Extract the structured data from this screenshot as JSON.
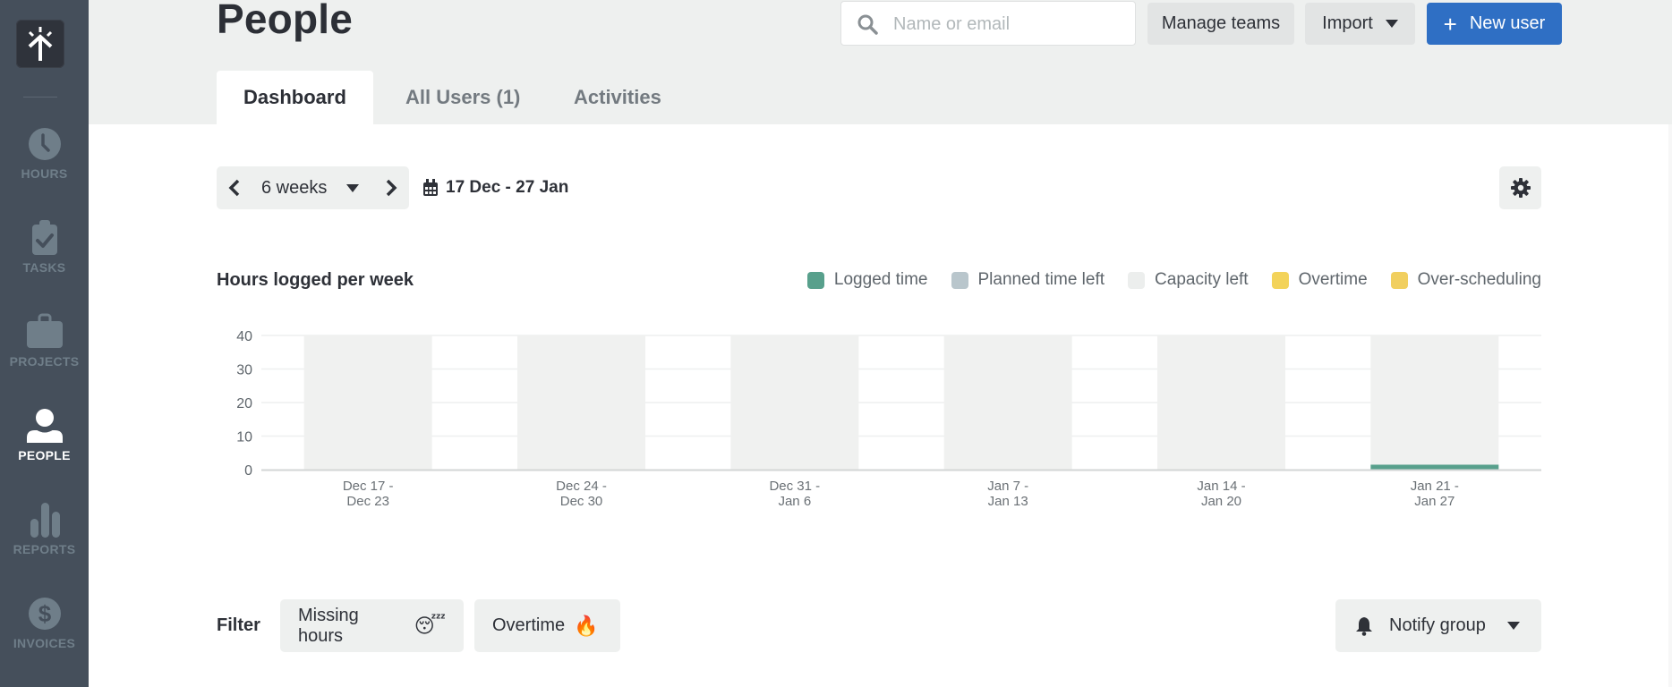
{
  "sidebar": {
    "logo_icon": "arrow-up-burst-logo-icon",
    "items": [
      {
        "label": "HOURS",
        "icon": "clock-icon",
        "active": false
      },
      {
        "label": "TASKS",
        "icon": "clipboard-check-icon",
        "active": false
      },
      {
        "label": "PROJECTS",
        "icon": "briefcase-icon",
        "active": false
      },
      {
        "label": "PEOPLE",
        "icon": "user-icon",
        "active": true
      },
      {
        "label": "REPORTS",
        "icon": "bar-chart-icon",
        "active": false
      },
      {
        "label": "INVOICES",
        "icon": "dollar-circle-icon",
        "active": false
      }
    ]
  },
  "header": {
    "title": "People",
    "search": {
      "placeholder": "Name or email",
      "value": ""
    },
    "manage_teams_label": "Manage teams",
    "import_label": "Import",
    "new_user_label": "New user",
    "new_user_icon": "+"
  },
  "tabs": [
    {
      "label": "Dashboard",
      "active": true
    },
    {
      "label": "All Users (1)",
      "active": false
    },
    {
      "label": "Activities",
      "active": false
    }
  ],
  "controls": {
    "period_label": "6 weeks",
    "date_range": "17 Dec - 27 Jan"
  },
  "colors": {
    "sidebar_bg": "#454f5b",
    "accent_blue": "#2f6fc4",
    "logged_time": "#58a08c",
    "planned_time_left": "#b9c6cc",
    "capacity_left": "#f0f1f0",
    "overtime": "#f3d35a",
    "over_scheduling": "#f1cf5f"
  },
  "chart_data": {
    "type": "bar",
    "title": "Hours logged per week",
    "xlabel": "",
    "ylabel": "",
    "ylim": [
      0,
      40
    ],
    "yticks": [
      0,
      10,
      20,
      30,
      40
    ],
    "grid": true,
    "legend_position": "top-right",
    "legend": [
      "Logged time",
      "Planned time left",
      "Capacity left",
      "Overtime",
      "Over-scheduling"
    ],
    "categories": [
      [
        "Dec 17 -",
        "Dec 23"
      ],
      [
        "Dec 24 -",
        "Dec 30"
      ],
      [
        "Dec 31 -",
        "Jan 6"
      ],
      [
        "Jan 7 -",
        "Jan 13"
      ],
      [
        "Jan 14 -",
        "Jan 20"
      ],
      [
        "Jan 21 -",
        "Jan 27"
      ]
    ],
    "series": [
      {
        "name": "Logged time",
        "values": [
          0,
          0,
          0,
          0,
          0,
          1.5
        ]
      },
      {
        "name": "Planned time left",
        "values": [
          0,
          0,
          0,
          0,
          0,
          0
        ]
      },
      {
        "name": "Capacity left",
        "values": [
          40,
          40,
          40,
          40,
          40,
          38.5
        ]
      },
      {
        "name": "Overtime",
        "values": [
          0,
          0,
          0,
          0,
          0,
          0
        ]
      },
      {
        "name": "Over-scheduling",
        "values": [
          0,
          0,
          0,
          0,
          0,
          0
        ]
      }
    ]
  },
  "filter": {
    "label": "Filter",
    "chips": [
      {
        "label": "Missing hours",
        "emoji": "😴"
      },
      {
        "label": "Overtime",
        "emoji": "🔥"
      }
    ],
    "notify_label": "Notify group"
  }
}
